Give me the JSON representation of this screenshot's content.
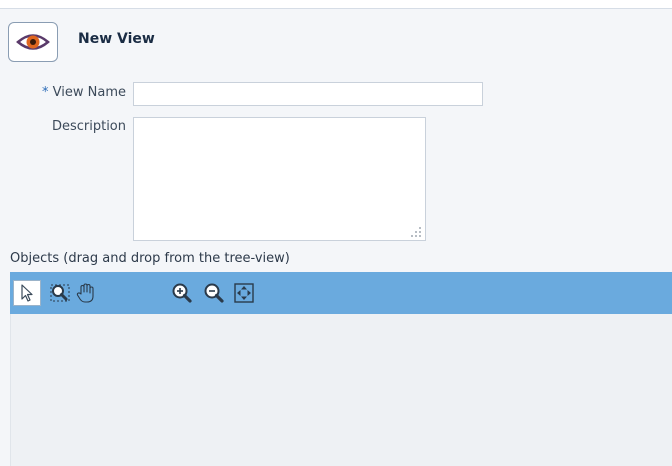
{
  "header": {
    "title": "New View",
    "icon": "eye-icon"
  },
  "form": {
    "view_name": {
      "required_mark": "*",
      "label": "View Name",
      "value": ""
    },
    "description": {
      "label": "Description",
      "value": ""
    }
  },
  "objects": {
    "label": "Objects (drag and drop from the tree-view)",
    "toolbar": [
      {
        "name": "select-pointer-icon",
        "active": true
      },
      {
        "name": "zoom-area-icon",
        "active": false
      },
      {
        "name": "pan-hand-icon",
        "active": false
      },
      {
        "name": "zoom-in-icon",
        "active": false
      },
      {
        "name": "zoom-out-icon",
        "active": false
      },
      {
        "name": "fit-to-screen-icon",
        "active": false
      }
    ]
  },
  "colors": {
    "toolbar": "#6aaade",
    "header_title": "#1a2c44",
    "accent": "#2c6cb8"
  }
}
